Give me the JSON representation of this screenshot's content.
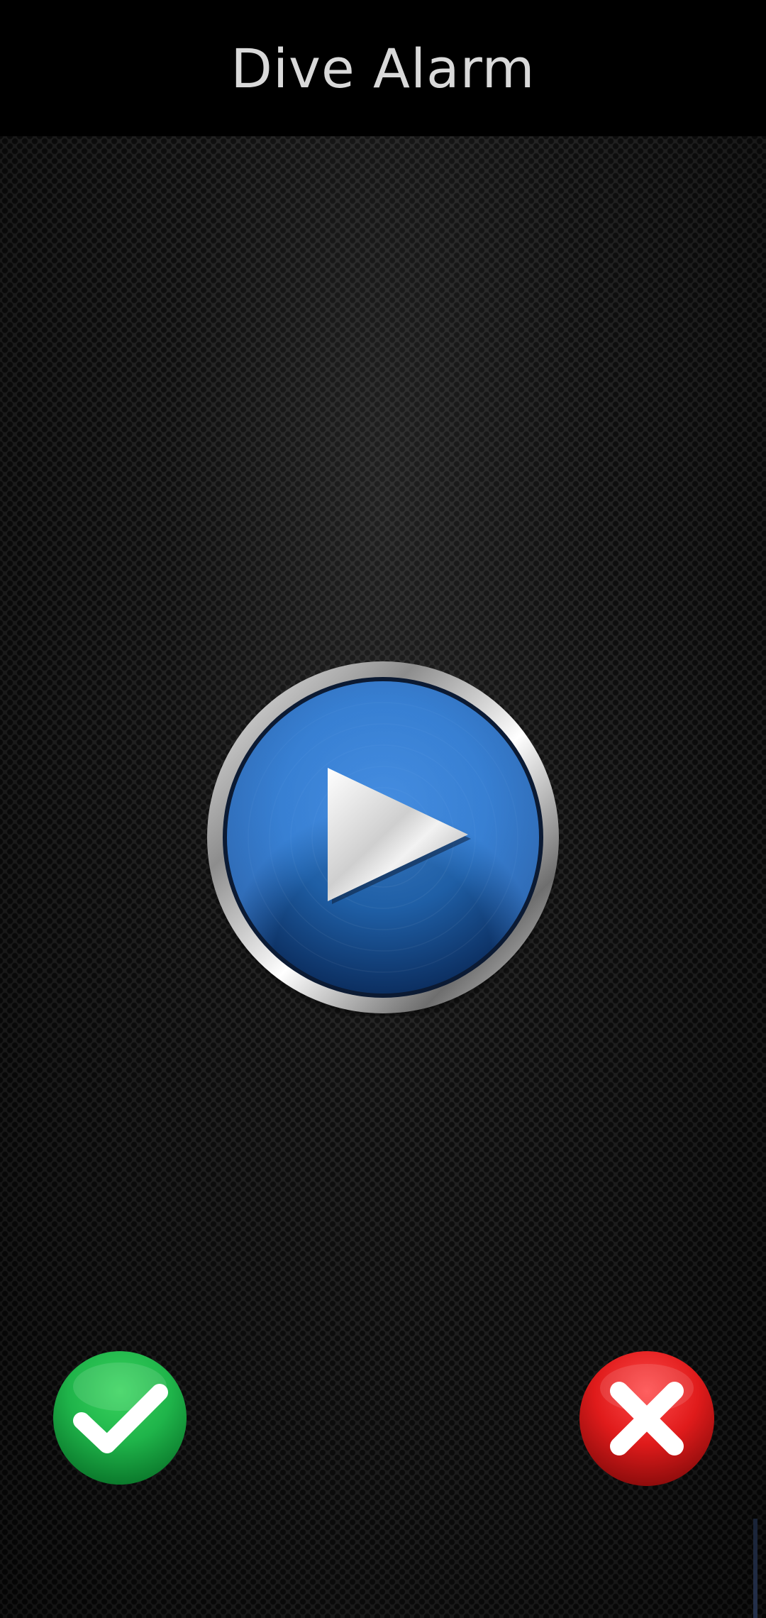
{
  "app": {
    "title": "Dive Alarm"
  },
  "controls": {
    "play_icon": "play-icon",
    "confirm_icon": "checkmark-icon",
    "cancel_icon": "close-icon"
  },
  "colors": {
    "play_blue": "#1f5fa6",
    "confirm_green": "#1fb44a",
    "cancel_red": "#e01b1b",
    "title_text": "#d9d9d9"
  }
}
